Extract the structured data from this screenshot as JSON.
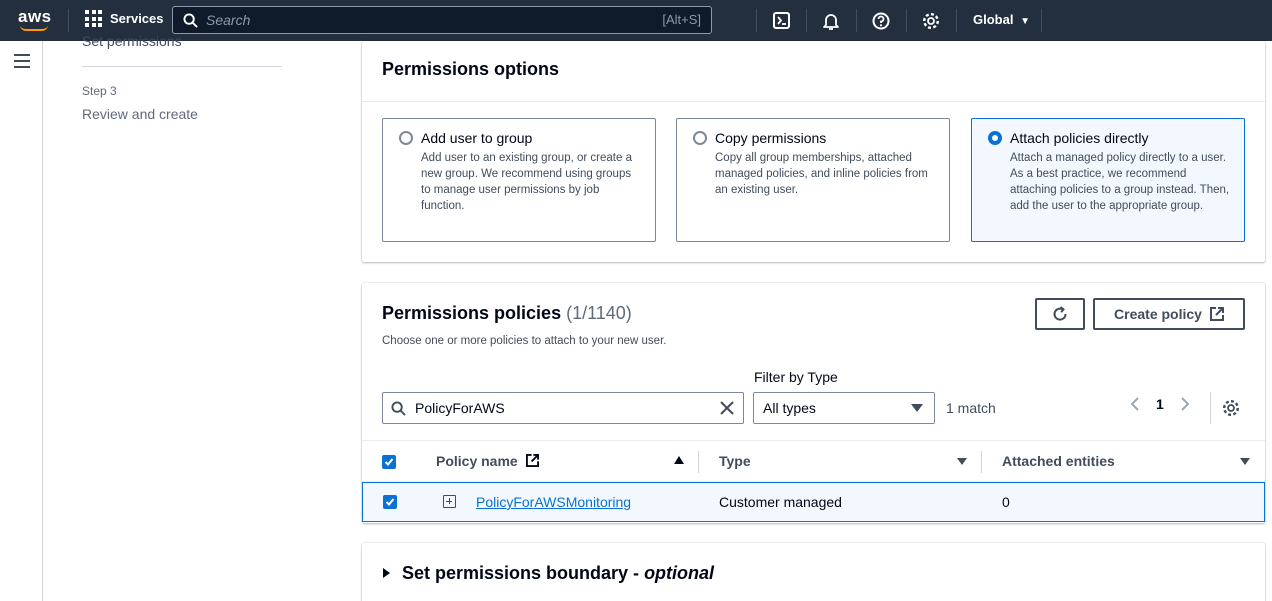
{
  "topnav": {
    "logo": "aws",
    "services_label": "Services",
    "search_placeholder": "Search",
    "search_shortcut": "[Alt+S]",
    "region_label": "Global",
    "icons": [
      "cloudshell-icon",
      "notifications-icon",
      "help-icon",
      "settings-icon"
    ]
  },
  "steps": {
    "previous_label": "Set permissions",
    "step3_small": "Step 3",
    "step3_label": "Review and create"
  },
  "permissions_options": {
    "title": "Permissions options",
    "tiles": [
      {
        "title": "Add user to group",
        "description": "Add user to an existing group, or create a new group. We recommend using groups to manage user permissions by job function.",
        "selected": false
      },
      {
        "title": "Copy permissions",
        "description": "Copy all group memberships, attached managed policies, and inline policies from an existing user.",
        "selected": false
      },
      {
        "title": "Attach policies directly",
        "description": "Attach a managed policy directly to a user. As a best practice, we recommend attaching policies to a group instead. Then, add the user to the appropriate group.",
        "selected": true
      }
    ]
  },
  "permissions_policies": {
    "title": "Permissions policies",
    "count": "(1/1140)",
    "description": "Choose one or more policies to attach to your new user.",
    "create_policy_label": "Create policy",
    "search_value": "PolicyForAWS",
    "filter_label": "Filter by Type",
    "filter_value": "All types",
    "match_text": "1 match",
    "page_number": "1",
    "columns": [
      "Policy name",
      "Type",
      "Attached entities"
    ],
    "rows": [
      {
        "name": "PolicyForAWSMonitoring",
        "type": "Customer managed",
        "attached": "0",
        "selected": true
      }
    ]
  },
  "boundary": {
    "title_main": "Set permissions boundary - ",
    "title_optional": "optional"
  },
  "colors": {
    "nav_bg": "#232f3e",
    "accent": "#0972d3",
    "selected_bg": "#f2f8fd"
  }
}
